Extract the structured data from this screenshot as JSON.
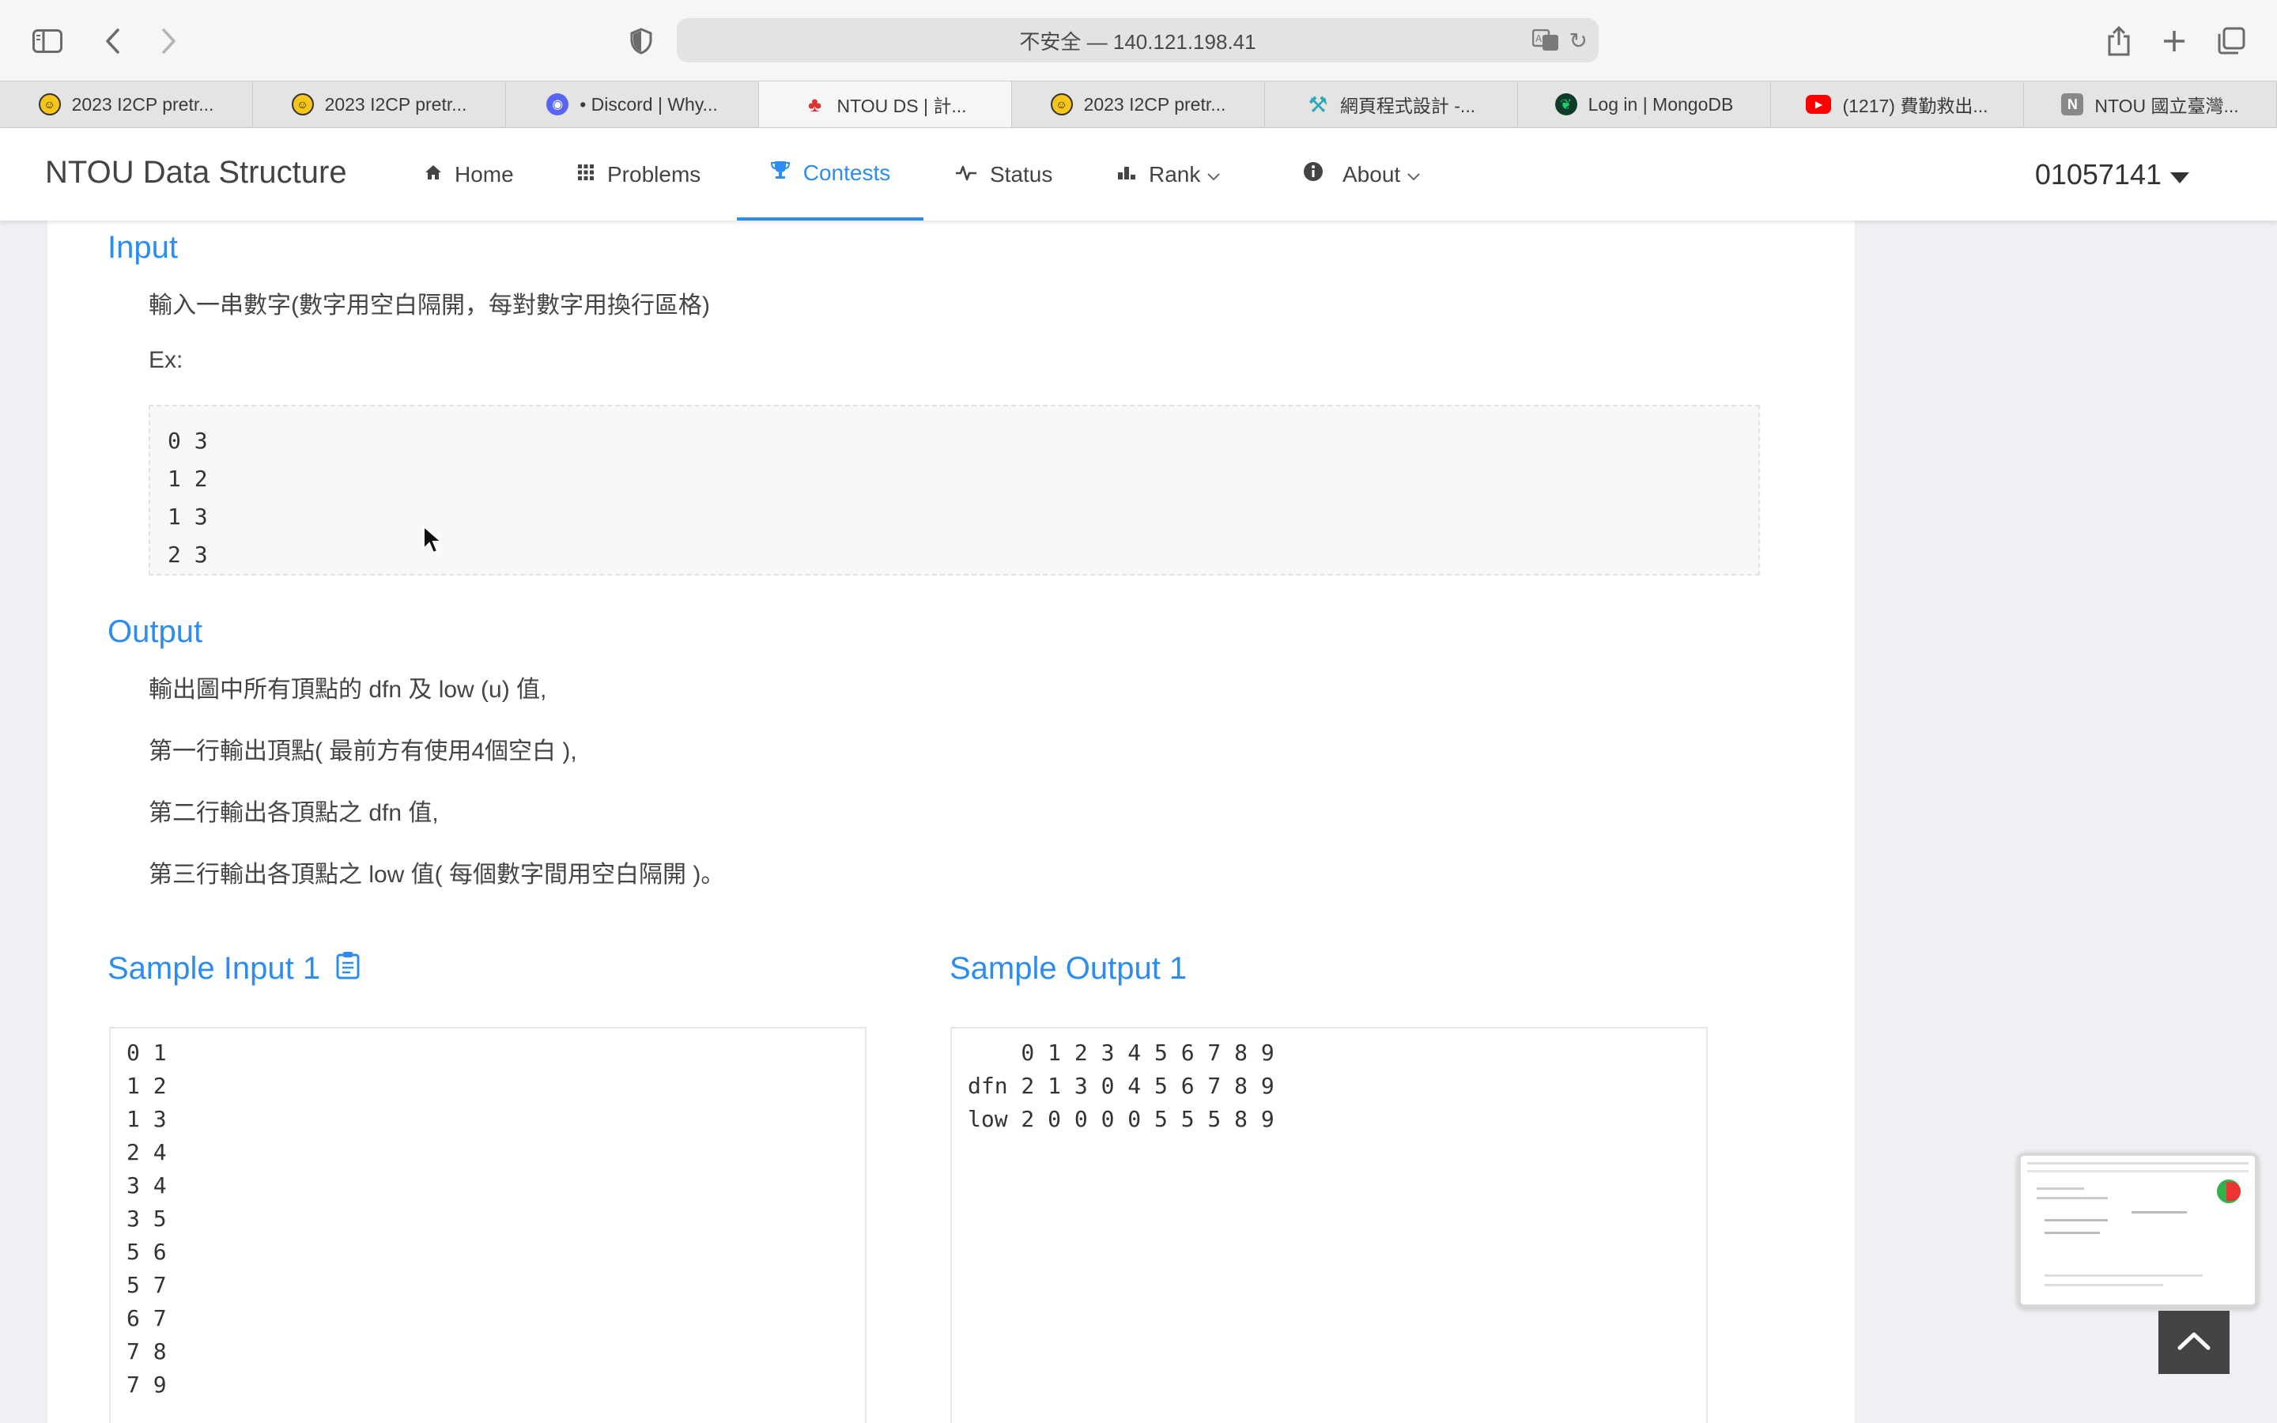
{
  "browser": {
    "address": "不安全 — 140.121.198.41",
    "tabs": [
      {
        "label": "2023 I2CP pretr...",
        "icon": "smiley-icon"
      },
      {
        "label": "2023 I2CP pretr...",
        "icon": "smiley-icon"
      },
      {
        "label": "• Discord | Why...",
        "icon": "discord-icon"
      },
      {
        "label": "NTOU DS | 計...",
        "icon": "ntou-icon",
        "active": true
      },
      {
        "label": "2023 I2CP pretr...",
        "icon": "smiley-icon"
      },
      {
        "label": "網頁程式設計 -...",
        "icon": "web-icon"
      },
      {
        "label": "Log in | MongoDB",
        "icon": "mongodb-icon"
      },
      {
        "label": "(1217) 費勤救出...",
        "icon": "youtube-icon"
      },
      {
        "label": "NTOU 國立臺灣...",
        "icon": "notion-icon"
      }
    ]
  },
  "nav": {
    "brand": "NTOU Data Structure",
    "items": {
      "home": "Home",
      "problems": "Problems",
      "contests": "Contests",
      "status": "Status",
      "rank": "Rank",
      "about": "About"
    },
    "user": "01057141"
  },
  "problem": {
    "input_title": "Input",
    "input_desc": "輸入一串數字(數字用空白隔開，每對數字用換行區格)",
    "ex_label": "Ex:",
    "ex_code": "0 3\n1 2\n1 3\n2 3",
    "output_title": "Output",
    "output_lines": [
      "輸出圖中所有頂點的 dfn 及 low (u) 值,",
      "第一行輸出頂點( 最前方有使用4個空白 ),",
      "第二行輸出各頂點之 dfn 值,",
      "第三行輸出各頂點之 low 值( 每個數字間用空白隔開 )。"
    ],
    "sample_input_title": "Sample Input 1",
    "sample_output_title": "Sample Output 1",
    "sample_input": "0 1\n1 2\n1 3\n2 4\n3 4\n3 5\n5 6\n5 7\n6 7\n7 8\n7 9",
    "sample_output": "    0 1 2 3 4 5 6 7 8 9\ndfn 2 1 3 0 4 5 6 7 8 9\nlow 2 0 0 0 0 5 5 5 8 9"
  },
  "colors": {
    "accent": "#2d8cf0",
    "chrome": "#f6f6f6",
    "page_bg": "#eef0f3"
  }
}
